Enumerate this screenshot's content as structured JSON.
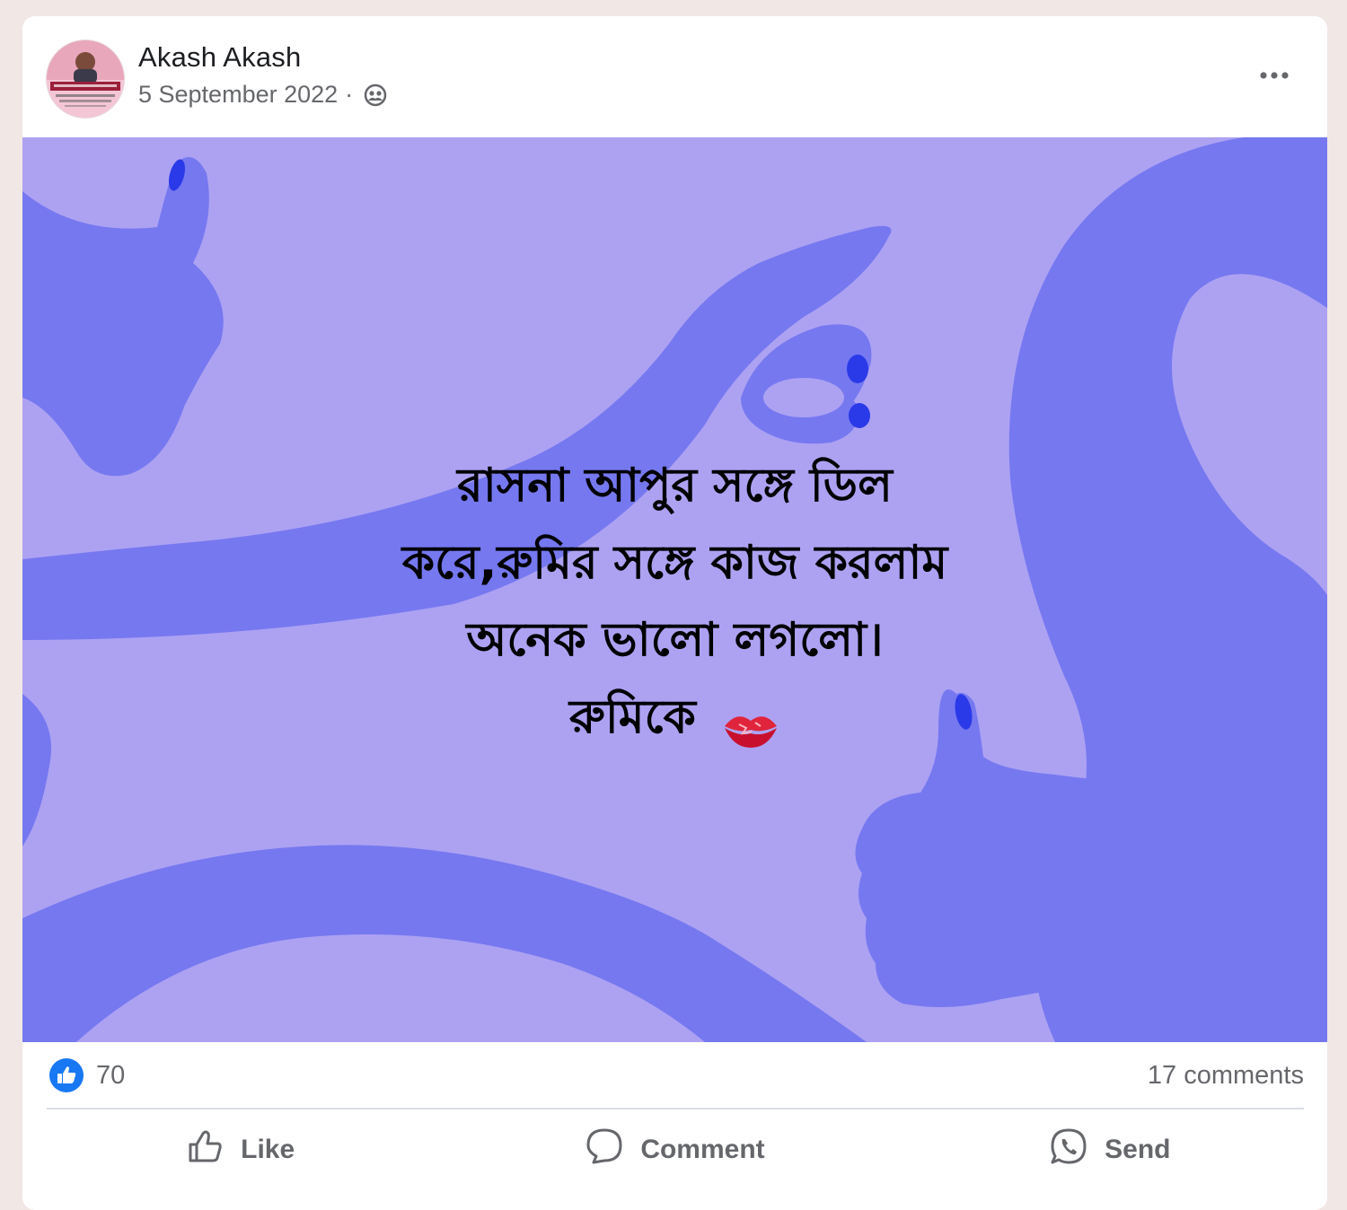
{
  "post": {
    "author": "Akash Akash",
    "date": "5 September 2022",
    "separator": "·",
    "audience_icon": "group-icon",
    "more_icon": "more-horizontal-icon",
    "text_lines": [
      "রাসনা আপুর সঙ্গে ডিল",
      "করে,রুমির সঙ্গে কাজ করলাম",
      "অনেক ভালো লগলো।",
      "রুমিকে"
    ],
    "emoji": "kiss-mark-emoji",
    "background_color": "#ada2f2",
    "shape_color": "#7678f0",
    "nail_color": "#2a3ae8"
  },
  "stats": {
    "reaction_icon": "like-reaction-icon",
    "likes": "70",
    "comments": "17 comments"
  },
  "actions": {
    "like_label": "Like",
    "comment_label": "Comment",
    "send_label": "Send",
    "like_icon": "thumbs-up-icon",
    "comment_icon": "comment-bubble-icon",
    "send_icon": "whatsapp-icon"
  },
  "colors": {
    "accent": "#1877f2",
    "muted_text": "#65676b"
  }
}
